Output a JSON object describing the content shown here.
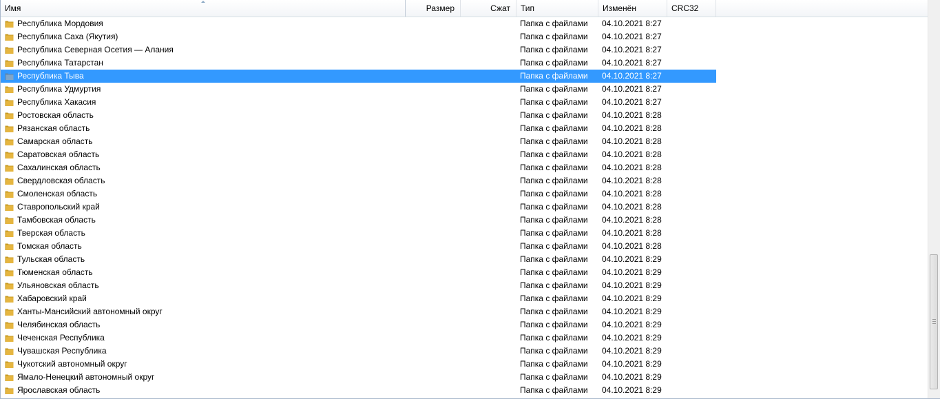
{
  "columns": {
    "name": "Имя",
    "size": "Размер",
    "packed": "Сжат",
    "type": "Тип",
    "modified": "Изменён",
    "crc": "CRC32"
  },
  "colors": {
    "selection": "#3399ff",
    "folder": "#e6b640"
  },
  "rows": [
    {
      "name": "Республика Мордовия",
      "type": "Папка с файлами",
      "modified": "04.10.2021 8:27"
    },
    {
      "name": "Республика Саха (Якутия)",
      "type": "Папка с файлами",
      "modified": "04.10.2021 8:27"
    },
    {
      "name": "Республика Северная Осетия — Алания",
      "type": "Папка с файлами",
      "modified": "04.10.2021 8:27"
    },
    {
      "name": "Республика Татарстан",
      "type": "Папка с файлами",
      "modified": "04.10.2021 8:27"
    },
    {
      "name": "Республика Тыва",
      "type": "Папка с файлами",
      "modified": "04.10.2021 8:27",
      "selected": true
    },
    {
      "name": "Республика Удмуртия",
      "type": "Папка с файлами",
      "modified": "04.10.2021 8:27"
    },
    {
      "name": "Республика Хакасия",
      "type": "Папка с файлами",
      "modified": "04.10.2021 8:27"
    },
    {
      "name": "Ростовская область",
      "type": "Папка с файлами",
      "modified": "04.10.2021 8:28"
    },
    {
      "name": "Рязанская область",
      "type": "Папка с файлами",
      "modified": "04.10.2021 8:28"
    },
    {
      "name": "Самарская область",
      "type": "Папка с файлами",
      "modified": "04.10.2021 8:28"
    },
    {
      "name": "Саратовская область",
      "type": "Папка с файлами",
      "modified": "04.10.2021 8:28"
    },
    {
      "name": "Сахалинская область",
      "type": "Папка с файлами",
      "modified": "04.10.2021 8:28"
    },
    {
      "name": "Свердловская область",
      "type": "Папка с файлами",
      "modified": "04.10.2021 8:28"
    },
    {
      "name": "Смоленская область",
      "type": "Папка с файлами",
      "modified": "04.10.2021 8:28"
    },
    {
      "name": "Ставропольский край",
      "type": "Папка с файлами",
      "modified": "04.10.2021 8:28"
    },
    {
      "name": "Тамбовская область",
      "type": "Папка с файлами",
      "modified": "04.10.2021 8:28"
    },
    {
      "name": "Тверская область",
      "type": "Папка с файлами",
      "modified": "04.10.2021 8:28"
    },
    {
      "name": "Томская область",
      "type": "Папка с файлами",
      "modified": "04.10.2021 8:28"
    },
    {
      "name": "Тульская область",
      "type": "Папка с файлами",
      "modified": "04.10.2021 8:29"
    },
    {
      "name": "Тюменская область",
      "type": "Папка с файлами",
      "modified": "04.10.2021 8:29"
    },
    {
      "name": "Ульяновская область",
      "type": "Папка с файлами",
      "modified": "04.10.2021 8:29"
    },
    {
      "name": "Хабаровский край",
      "type": "Папка с файлами",
      "modified": "04.10.2021 8:29"
    },
    {
      "name": "Ханты-Мансийский автономный округ",
      "type": "Папка с файлами",
      "modified": "04.10.2021 8:29"
    },
    {
      "name": "Челябинская область",
      "type": "Папка с файлами",
      "modified": "04.10.2021 8:29"
    },
    {
      "name": "Чеченская Республика",
      "type": "Папка с файлами",
      "modified": "04.10.2021 8:29"
    },
    {
      "name": "Чувашская Республика",
      "type": "Папка с файлами",
      "modified": "04.10.2021 8:29"
    },
    {
      "name": "Чукотский автономный округ",
      "type": "Папка с файлами",
      "modified": "04.10.2021 8:29"
    },
    {
      "name": "Ямало-Ненецкий автономный округ",
      "type": "Папка с файлами",
      "modified": "04.10.2021 8:29"
    },
    {
      "name": "Ярославская область",
      "type": "Папка с файлами",
      "modified": "04.10.2021 8:29"
    }
  ]
}
